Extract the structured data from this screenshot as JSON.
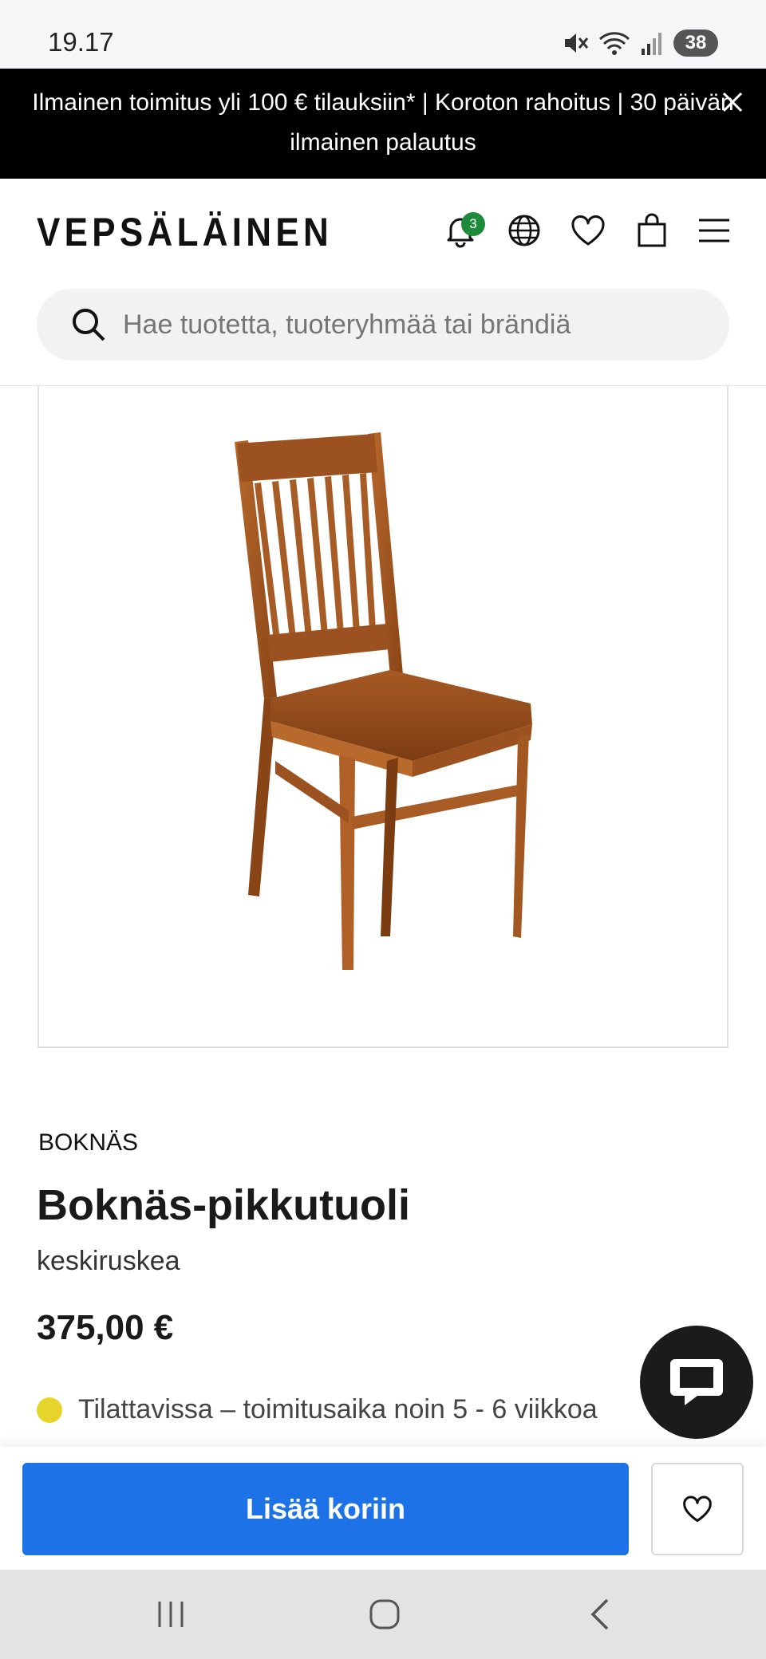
{
  "status_bar": {
    "time": "19.17",
    "battery": "38"
  },
  "promo": {
    "text": "Ilmainen toimitus yli 100 € tilauksiin* | Koroton rahoitus | 30 päivän ilmainen palautus"
  },
  "header": {
    "logo": "VEPSÄLÄINEN",
    "notification_count": "3",
    "icons": [
      "bell-icon",
      "globe-icon",
      "heart-icon",
      "shopping-bag-icon",
      "menu-icon"
    ]
  },
  "search": {
    "placeholder": "Hae tuotetta, tuoteryhmää tai brändiä"
  },
  "product": {
    "brand": "BOKNÄS",
    "title": "Boknäs-pikkutuoli",
    "variant": "keskiruskea",
    "price": "375,00 €",
    "availability": "Tilattavissa – toimitusaika noin 5 - 6 viikkoa",
    "availability_color": "#e6d42a"
  },
  "actions": {
    "add_to_cart": "Lisää koriin"
  },
  "colors": {
    "accent": "#1d72e8",
    "promo_bg": "#000000",
    "badge": "#1f8a3c"
  }
}
